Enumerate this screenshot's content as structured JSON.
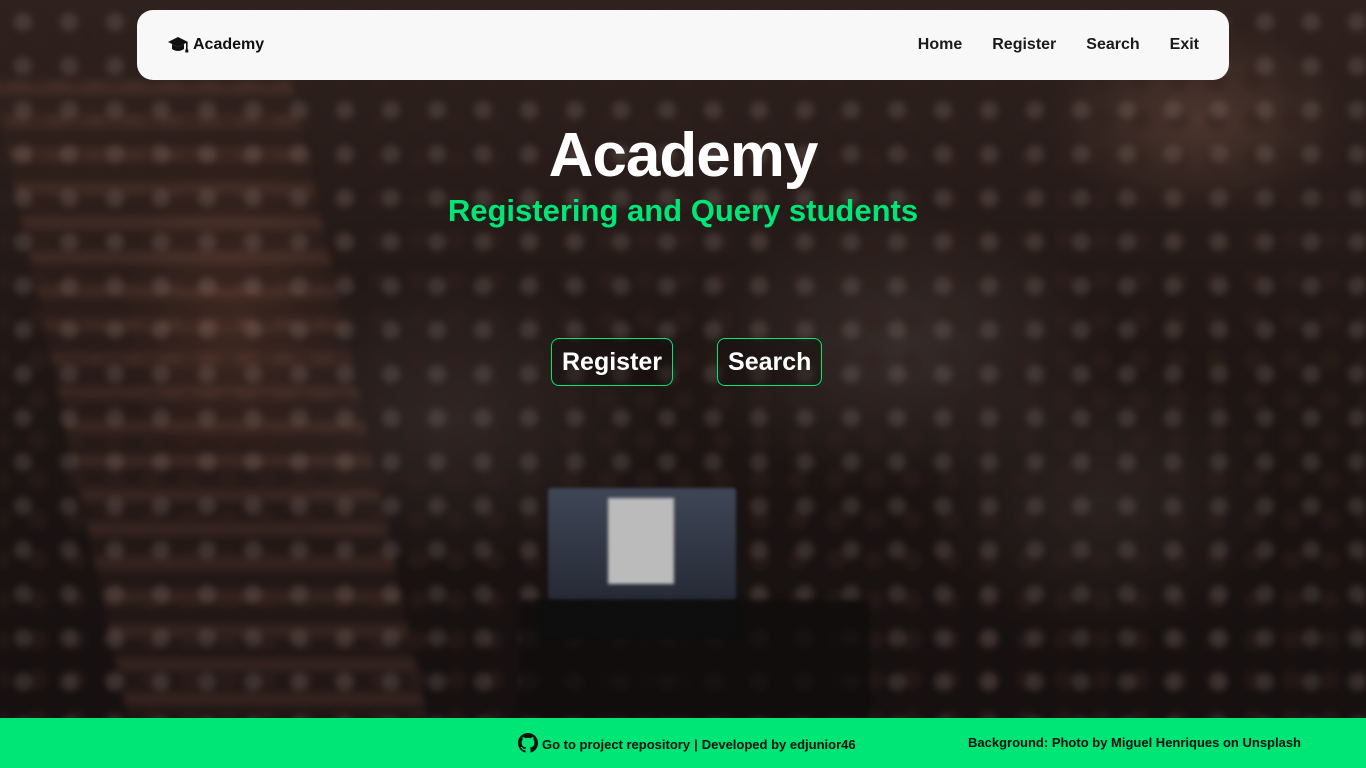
{
  "navbar": {
    "brand_label": "Academy",
    "brand_icon": "graduation-cap-icon",
    "links": [
      {
        "label": "Home"
      },
      {
        "label": "Register"
      },
      {
        "label": "Search"
      },
      {
        "label": "Exit"
      }
    ]
  },
  "hero": {
    "title": "Academy",
    "subtitle": "Registering and Query students",
    "buttons": [
      {
        "label": "Register"
      },
      {
        "label": "Search"
      }
    ]
  },
  "footer": {
    "repo_icon": "github-icon",
    "repo_link_label": "Go to project repository",
    "separator": "|",
    "developer_text": "Developed by edjunior46",
    "credit_text": "Background: Photo by Miguel Henriques on Unsplash"
  },
  "colors": {
    "accent": "#00e676",
    "navbar_bg": "#f8f8f8",
    "footer_bg": "#00e676"
  }
}
